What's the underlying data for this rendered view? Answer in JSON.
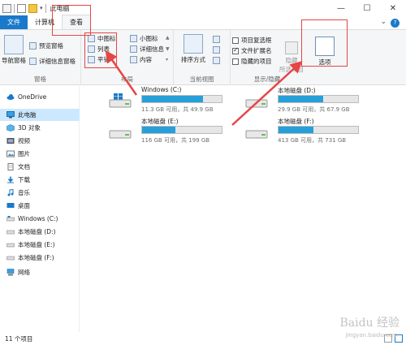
{
  "window": {
    "title": "此电脑",
    "minimize": "—",
    "maximize": "☐",
    "close": "✕"
  },
  "tabs": [
    {
      "label": "文件"
    },
    {
      "label": "计算机"
    },
    {
      "label": "查看"
    }
  ],
  "help_label": "?",
  "ribbon": {
    "pane_group": {
      "label": "窗格",
      "nav_pane": "导航窗格",
      "preview_pane": "预览窗格",
      "details_pane": "详细信息窗格"
    },
    "layout_group": {
      "label": "布局",
      "medium_icons": "中图标",
      "small_icons": "小图标",
      "list": "列表",
      "details": "详细信息",
      "tiles": "平铺",
      "content": "内容"
    },
    "current_view_group": {
      "label": "当前视图",
      "sort_by": "排序方式"
    },
    "show_hide_group": {
      "label": "显示/隐藏",
      "item_checkboxes": "项目复选框",
      "file_extensions": "文件扩展名",
      "hidden_items": "隐藏的项目",
      "hide_label": "隐藏",
      "selected_items": "所选项目",
      "item_checkboxes_checked": false,
      "file_extensions_checked": true,
      "hidden_items_checked": false
    },
    "options_label": "选项"
  },
  "nav": {
    "items": [
      {
        "label": "OneDrive"
      },
      {
        "label": "此电脑"
      },
      {
        "label": "3D 对象"
      },
      {
        "label": "视频"
      },
      {
        "label": "图片"
      },
      {
        "label": "文档"
      },
      {
        "label": "下载"
      },
      {
        "label": "音乐"
      },
      {
        "label": "桌面"
      },
      {
        "label": "Windows (C:)"
      },
      {
        "label": "本地磁盘 (D:)"
      },
      {
        "label": "本地磁盘 (E:)"
      },
      {
        "label": "本地磁盘 (F:)"
      },
      {
        "label": "网络"
      }
    ]
  },
  "drives": [
    {
      "name": "Windows (C:)",
      "free": "11.3 GB 可用，共 49.9 GB",
      "used_fraction": 0.77
    },
    {
      "name": "本地磁盘 (D:)",
      "free": "29.9 GB 可用，共 67.9 GB",
      "used_fraction": 0.56
    },
    {
      "name": "本地磁盘 (E:)",
      "free": "116 GB 可用，共 199 GB",
      "used_fraction": 0.42
    },
    {
      "name": "本地磁盘 (F:)",
      "free": "413 GB 可用，共 731 GB",
      "used_fraction": 0.44
    }
  ],
  "status": {
    "item_count": "11 个项目"
  },
  "watermark": {
    "brand": "Baidu 经验",
    "url": "jingyan.baidu.com"
  },
  "colors": {
    "accent": "#1979ca",
    "highlight": "#e54646",
    "drive_bar": "#26a0da",
    "selection": "#cce8ff"
  }
}
